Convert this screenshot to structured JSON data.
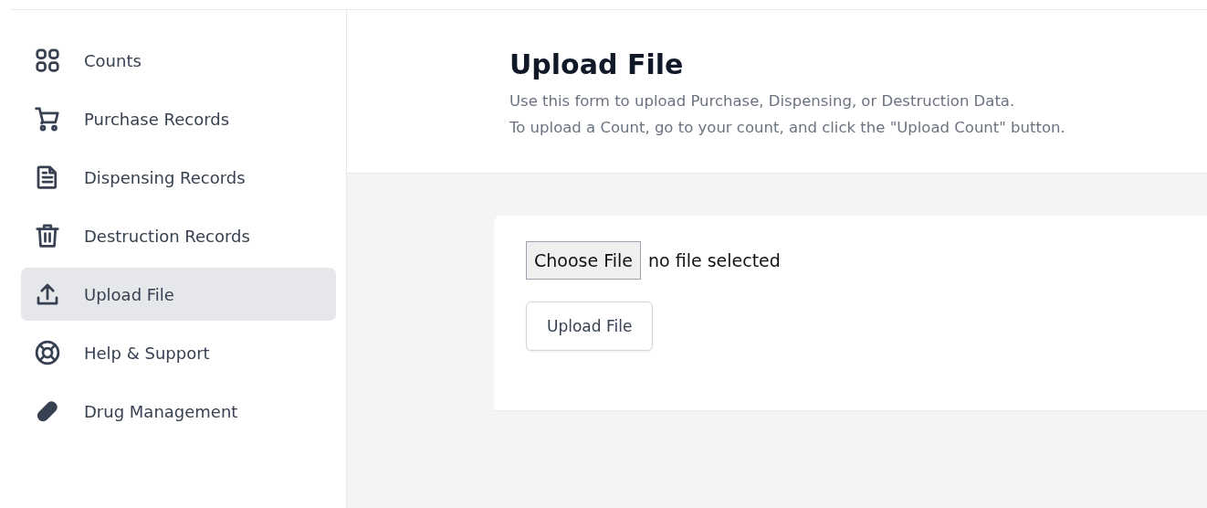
{
  "sidebar": {
    "items": [
      {
        "label": "Counts",
        "selected": false
      },
      {
        "label": "Purchase Records",
        "selected": false
      },
      {
        "label": "Dispensing Records",
        "selected": false
      },
      {
        "label": "Destruction Records",
        "selected": false
      },
      {
        "label": "Upload File",
        "selected": true
      },
      {
        "label": "Help & Support",
        "selected": false
      },
      {
        "label": "Drug Management",
        "selected": false
      }
    ]
  },
  "header": {
    "title": "Upload File",
    "description": [
      "Use this form to upload Purchase, Dispensing, or Destruction Data.",
      "To upload a Count, go to your count, and click the \"Upload Count\" button."
    ]
  },
  "form": {
    "file_picker": {
      "button": "Choose File",
      "status": "no file selected"
    },
    "submit": "Upload File"
  }
}
